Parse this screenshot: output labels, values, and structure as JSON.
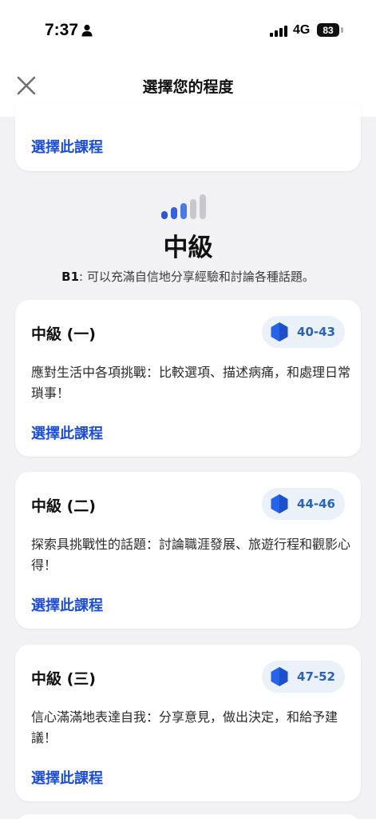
{
  "status_bar": {
    "time": "7:37",
    "network": "4G",
    "battery": "83"
  },
  "nav": {
    "title": "選擇您的程度"
  },
  "select_label": "選擇此課程",
  "level": {
    "title": "中級",
    "code": "B1",
    "description": ": 可以充滿自信地分享經驗和討論各種話題。"
  },
  "courses": [
    {
      "title": "中級 (一)",
      "range": "40-43",
      "description": "應對生活中各項挑戰：比較選項、描述病痛，和處理日常瑣事！"
    },
    {
      "title": "中級 (二)",
      "range": "44-46",
      "description": "探索具挑戰性的話題：討論職涯發展、旅遊行程和觀影心得！"
    },
    {
      "title": "中級 (三)",
      "range": "47-52",
      "description": "信心滿滿地表達自我：分享意見，做出決定，和給予建議！"
    }
  ],
  "colors": {
    "accent": "#1d4ed8",
    "badge_bg": "#eaf1f8",
    "badge_text": "#2b63b6",
    "background": "#f2f2f4"
  }
}
